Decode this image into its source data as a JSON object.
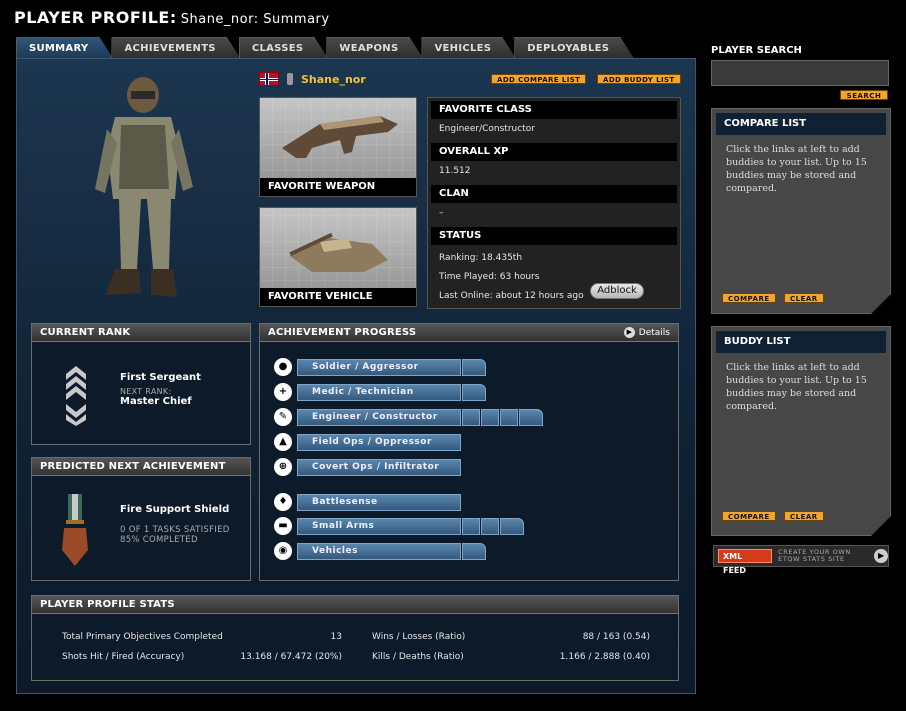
{
  "header": {
    "title": "PLAYER PROFILE:",
    "subtitle": "Shane_nor: Summary"
  },
  "tabs": [
    {
      "label": "SUMMARY",
      "active": true
    },
    {
      "label": "ACHIEVEMENTS"
    },
    {
      "label": "CLASSES"
    },
    {
      "label": "WEAPONS"
    },
    {
      "label": "VEHICLES"
    },
    {
      "label": "DEPLOYABLES"
    }
  ],
  "player": {
    "name": "Shane_nor",
    "add_compare": "ADD COMPARE LIST",
    "add_buddy": "ADD BUDDY LIST"
  },
  "favorites": {
    "weapon_label": "FAVORITE WEAPON",
    "vehicle_label": "FAVORITE VEHICLE"
  },
  "info": {
    "fav_class_label": "FAVORITE CLASS",
    "fav_class": "Engineer/Constructor",
    "xp_label": "OVERALL XP",
    "xp": "11.512",
    "clan_label": "CLAN",
    "clan": "–",
    "status_label": "STATUS",
    "ranking": "Ranking: 18.435th",
    "time_played": "Time Played: 63 hours",
    "last_online": "Last Online: about 12 hours ago"
  },
  "current_rank": {
    "title": "CURRENT RANK",
    "rank": "First Sergeant",
    "next_label": "NEXT RANK:",
    "next": "Master Chief"
  },
  "predicted": {
    "title": "PREDICTED NEXT ACHIEVEMENT",
    "name": "Fire Support Shield",
    "tasks": "0 OF 1 TASKS SATISFIED",
    "completed": "85% COMPLETED"
  },
  "achievement_progress": {
    "title": "ACHIEVEMENT PROGRESS",
    "details": "Details",
    "adblock": "Adblock",
    "rows": [
      {
        "label": "Soldier / Aggressor",
        "icon": "helmet-icon",
        "glyph": "●",
        "segments": 1
      },
      {
        "label": "Medic / Technician",
        "icon": "medic-cross-icon",
        "glyph": "+",
        "segments": 1
      },
      {
        "label": "Engineer / Constructor",
        "icon": "wrench-icon",
        "glyph": "✎",
        "segments": 4
      },
      {
        "label": "Field Ops / Oppressor",
        "icon": "artillery-icon",
        "glyph": "▲",
        "segments": 0
      },
      {
        "label": "Covert Ops / Infiltrator",
        "icon": "crosshair-icon",
        "glyph": "⊕",
        "segments": 0
      },
      {
        "label": "Battlesense",
        "icon": "shield-icon",
        "glyph": "♦",
        "segments": 0
      },
      {
        "label": "Small Arms",
        "icon": "pistol-icon",
        "glyph": "▬",
        "segments": 3
      },
      {
        "label": "Vehicles",
        "icon": "vehicle-icon",
        "glyph": "◉",
        "segments": 1
      }
    ]
  },
  "profile_stats": {
    "title": "PLAYER PROFILE STATS",
    "items": [
      {
        "label": "Total Primary Objectives Completed",
        "value": "13"
      },
      {
        "label": "Wins / Losses (Ratio)",
        "value": "88 / 163 (0.54)"
      },
      {
        "label": "Shots Hit / Fired (Accuracy)",
        "value": "13.168 / 67.472 (20%)"
      },
      {
        "label": "Kills / Deaths (Ratio)",
        "value": "1.166 / 2.888 (0.40)"
      }
    ]
  },
  "sidebar": {
    "search_label": "PLAYER SEARCH",
    "search_button": "SEARCH",
    "compare": {
      "title": "COMPARE LIST",
      "body": "Click the links at left to add buddies to your list. Up to 15 buddies may be stored and compared.",
      "compare_btn": "COMPARE",
      "clear_btn": "CLEAR"
    },
    "buddy": {
      "title": "BUDDY LIST",
      "body": "Click the links at left to add buddies to your list. Up to 15 buddies may be stored and compared.",
      "compare_btn": "COMPARE",
      "clear_btn": "CLEAR"
    },
    "xml": {
      "badge": "XML FEED",
      "text": "CREATE YOUR OWN ETQW STATS SITE"
    }
  }
}
